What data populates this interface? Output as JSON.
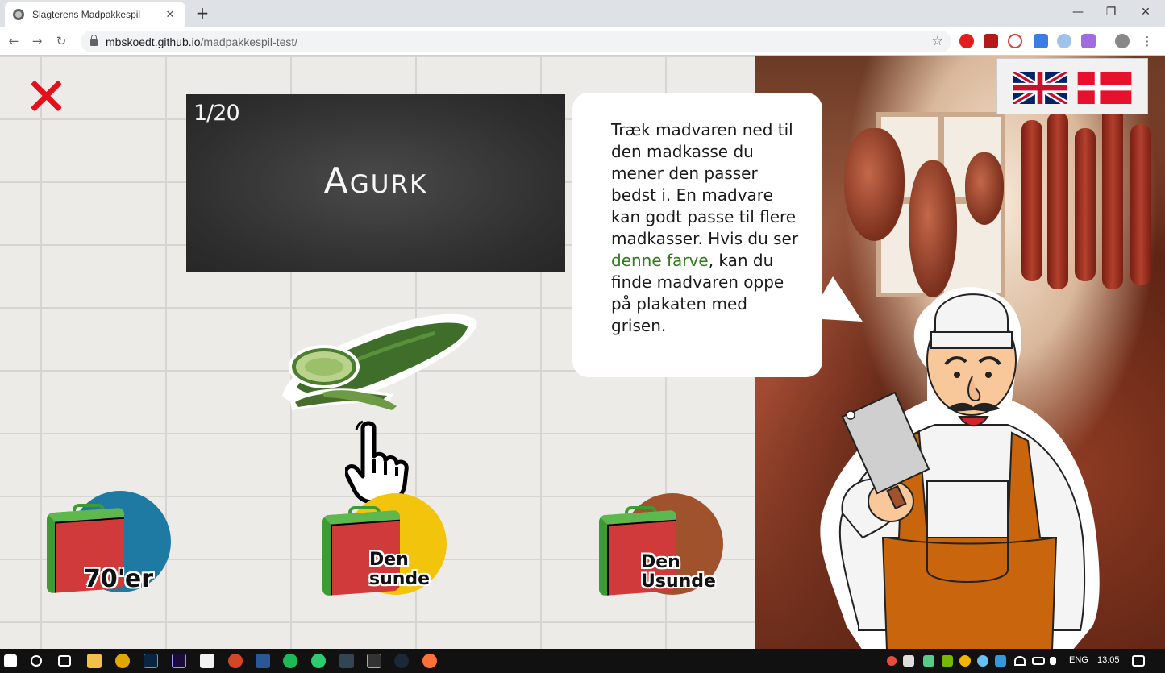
{
  "browser": {
    "tab_title": "Slagterens Madpakkespil",
    "tab_close": "✕",
    "new_tab": "+",
    "win_minimize": "—",
    "win_restore": "❐",
    "win_close": "✕",
    "back": "←",
    "forward": "→",
    "reload": "↻",
    "url_domain": "mbskoedt.github.io",
    "url_path": "/madpakkespil-test/",
    "bookmark_star": "☆",
    "menu_dots": "⋮"
  },
  "game": {
    "counter": "1/20",
    "food_word": "Agurk",
    "food_icon": "cucumber-icon",
    "instructions": {
      "part1": "Træk madvaren ned til den madkasse du mener den passer bedst i. En madvare kan godt passe til flere madkasser. Hvis du ser ",
      "highlight": "denne farve",
      "part2": ", kan du finde madvaren oppe på plakaten med grisen."
    },
    "highlight_color": "#2e7d18",
    "close_color": "#e3101c",
    "lunchboxes": [
      {
        "label_line1": "70'er",
        "label_line2": "",
        "circle_color": "#1e7aa3"
      },
      {
        "label_line1": "Den",
        "label_line2": "sunde",
        "circle_color": "#f2c40c"
      },
      {
        "label_line1": "Den",
        "label_line2": "Usunde",
        "circle_color": "#a0522d"
      }
    ],
    "languages": [
      "english-flag",
      "danish-flag"
    ]
  },
  "taskbar": {
    "language": "ENG",
    "time": "13:05"
  }
}
